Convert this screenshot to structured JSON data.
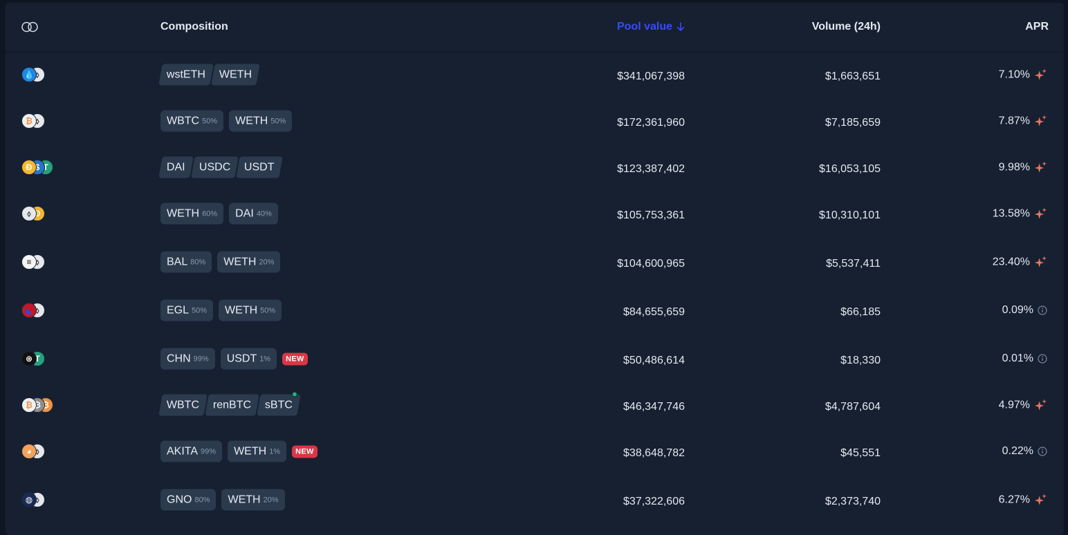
{
  "header": {
    "composition": "Composition",
    "pool_value": "Pool value",
    "volume": "Volume (24h)",
    "apr": "APR"
  },
  "colors": {
    "accent": "#384aff",
    "new_badge": "#dc3545",
    "online_dot": "#12b981"
  },
  "rows": [
    {
      "tokens": [
        "wsteth-icon",
        "weth-icon"
      ],
      "style": "slant",
      "pills": [
        {
          "symbol": "wstETH",
          "weight": ""
        },
        {
          "symbol": "WETH",
          "weight": ""
        }
      ],
      "new": "",
      "pool_value": "$341,067,398",
      "volume": "$1,663,651",
      "apr": "7.10%",
      "apr_icon": "sparkles-icon"
    },
    {
      "tokens": [
        "wbtc-icon",
        "weth-icon"
      ],
      "style": "weighted",
      "pills": [
        {
          "symbol": "WBTC",
          "weight": "50%"
        },
        {
          "symbol": "WETH",
          "weight": "50%"
        }
      ],
      "new": "",
      "pool_value": "$172,361,960",
      "volume": "$7,185,659",
      "apr": "7.87%",
      "apr_icon": "sparkles-icon"
    },
    {
      "tokens": [
        "dai-icon",
        "usdc-icon",
        "usdt-icon"
      ],
      "style": "slant",
      "pills": [
        {
          "symbol": "DAI",
          "weight": ""
        },
        {
          "symbol": "USDC",
          "weight": ""
        },
        {
          "symbol": "USDT",
          "weight": ""
        }
      ],
      "new": "",
      "pool_value": "$123,387,402",
      "volume": "$16,053,105",
      "apr": "9.98%",
      "apr_icon": "sparkles-icon"
    },
    {
      "tokens": [
        "weth-icon",
        "dai-icon"
      ],
      "style": "weighted",
      "pills": [
        {
          "symbol": "WETH",
          "weight": "60%"
        },
        {
          "symbol": "DAI",
          "weight": "40%"
        }
      ],
      "new": "",
      "pool_value": "$105,753,361",
      "volume": "$10,310,101",
      "apr": "13.58%",
      "apr_icon": "sparkles-icon"
    },
    {
      "tokens": [
        "bal-icon",
        "weth-icon"
      ],
      "style": "weighted",
      "pills": [
        {
          "symbol": "BAL",
          "weight": "80%"
        },
        {
          "symbol": "WETH",
          "weight": "20%"
        }
      ],
      "new": "",
      "pool_value": "$104,600,965",
      "volume": "$5,537,411",
      "apr": "23.40%",
      "apr_icon": "sparkles-icon"
    },
    {
      "tokens": [
        "egl-icon",
        "weth-icon"
      ],
      "style": "weighted",
      "pills": [
        {
          "symbol": "EGL",
          "weight": "50%"
        },
        {
          "symbol": "WETH",
          "weight": "50%"
        }
      ],
      "new": "",
      "pool_value": "$84,655,659",
      "volume": "$66,185",
      "apr": "0.09%",
      "apr_icon": "info-icon"
    },
    {
      "tokens": [
        "chn-icon",
        "usdt-icon"
      ],
      "style": "weighted",
      "pills": [
        {
          "symbol": "CHN",
          "weight": "99%"
        },
        {
          "symbol": "USDT",
          "weight": "1%"
        }
      ],
      "new": "NEW",
      "pool_value": "$50,486,614",
      "volume": "$18,330",
      "apr": "0.01%",
      "apr_icon": "info-icon"
    },
    {
      "tokens": [
        "wbtc-icon",
        "renbtc-icon",
        "sbtc-icon"
      ],
      "style": "slant",
      "pills": [
        {
          "symbol": "WBTC",
          "weight": ""
        },
        {
          "symbol": "renBTC",
          "weight": ""
        },
        {
          "symbol": "sBTC",
          "weight": "",
          "dot": true
        }
      ],
      "new": "",
      "pool_value": "$46,347,746",
      "volume": "$4,787,604",
      "apr": "4.97%",
      "apr_icon": "sparkles-icon"
    },
    {
      "tokens": [
        "akita-icon",
        "weth-icon"
      ],
      "style": "weighted",
      "pills": [
        {
          "symbol": "AKITA",
          "weight": "99%"
        },
        {
          "symbol": "WETH",
          "weight": "1%"
        }
      ],
      "new": "NEW",
      "pool_value": "$38,648,782",
      "volume": "$45,551",
      "apr": "0.22%",
      "apr_icon": "info-icon"
    },
    {
      "tokens": [
        "gno-icon",
        "weth-icon"
      ],
      "style": "weighted",
      "pills": [
        {
          "symbol": "GNO",
          "weight": "80%"
        },
        {
          "symbol": "WETH",
          "weight": "20%"
        }
      ],
      "new": "",
      "pool_value": "$37,322,606",
      "volume": "$2,373,740",
      "apr": "6.27%",
      "apr_icon": "sparkles-icon"
    }
  ]
}
